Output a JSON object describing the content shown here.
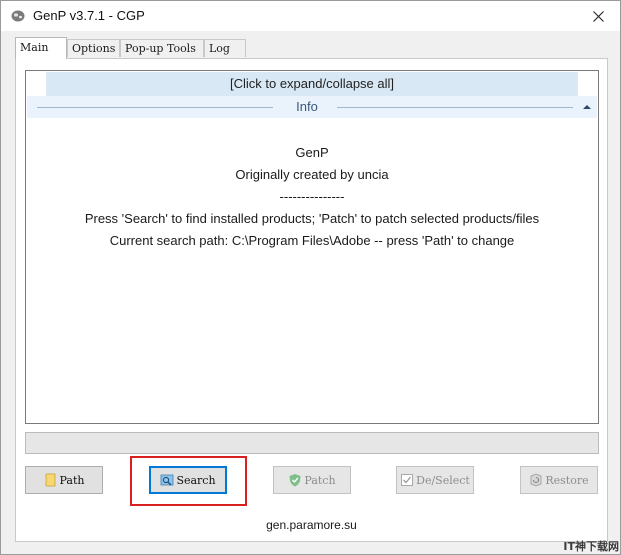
{
  "window": {
    "title": "GenP v3.7.1 - CGP",
    "close_symbol": "✕",
    "icon": "app-icon"
  },
  "tabs": [
    {
      "label": "Main",
      "active": true
    },
    {
      "label": "Options",
      "active": false
    },
    {
      "label": "Pop-up Tools",
      "active": false
    },
    {
      "label": "Log",
      "active": false
    }
  ],
  "main": {
    "expand_label": "[Click to expand/collapse all]",
    "section_title": "Info",
    "info_lines": [
      "GenP",
      "Originally created by uncia",
      "---------------",
      "Press 'Search' to find installed products; 'Patch' to patch selected products/files",
      "Current search path: C:\\Program Files\\Adobe -- press 'Path' to change"
    ]
  },
  "progress": {
    "value": 0
  },
  "buttons": {
    "path": {
      "label": "Path",
      "enabled": true,
      "icon": "folder-icon"
    },
    "search": {
      "label": "Search",
      "enabled": true,
      "focused": true,
      "icon": "search-icon"
    },
    "patch": {
      "label": "Patch",
      "enabled": false,
      "icon": "shield-check-icon"
    },
    "deselect": {
      "label": "De/Select",
      "enabled": false,
      "icon": "checklist-icon"
    },
    "restore": {
      "label": "Restore",
      "enabled": false,
      "icon": "restore-icon"
    }
  },
  "footer": {
    "link": "gen.paramore.su"
  },
  "watermark": "IT神下载网",
  "colors": {
    "accent": "#0078d7",
    "highlight": "#d9201f",
    "expand_bar": "#d9e8f5"
  }
}
